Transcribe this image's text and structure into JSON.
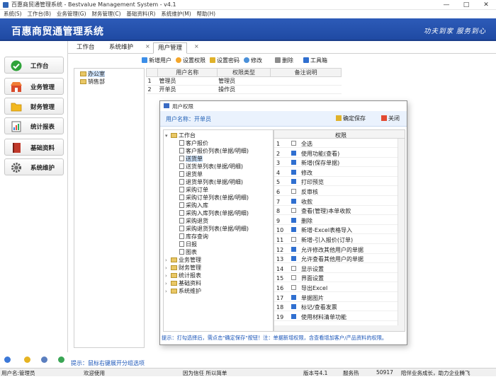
{
  "window": {
    "title": "百惠商贸通管理系统 - Bestvalue Management System - v4.1"
  },
  "menu": [
    "系统(S)",
    "工作台(B)",
    "业务管理(G)",
    "财务管理(C)",
    "基础资料(R)",
    "系统维护(M)",
    "帮助(H)"
  ],
  "banner": {
    "logo": "百惠商贸通管理系统",
    "slogan": "功夫到家 服务到心"
  },
  "nav": [
    {
      "label": "工作台",
      "icon": "check-icon"
    },
    {
      "label": "业务管理",
      "icon": "store-icon"
    },
    {
      "label": "财务管理",
      "icon": "folder-icon"
    },
    {
      "label": "统计报表",
      "icon": "report-icon"
    },
    {
      "label": "基础资料",
      "icon": "book-icon"
    },
    {
      "label": "系统维护",
      "icon": "gear-icon"
    }
  ],
  "tabs": [
    "工作台",
    "系统维护",
    "用户管理"
  ],
  "toolbar": {
    "add": "新增用户",
    "perm": "设置权限",
    "pwd": "设置密码",
    "edit": "修改",
    "del": "删除",
    "tools": "工具箱"
  },
  "org_tree": [
    "办公室",
    "销售部"
  ],
  "users": {
    "headers": [
      "用户名称",
      "权限类型",
      "备注说明"
    ],
    "rows": [
      {
        "n": "1",
        "name": "管理员",
        "type": "管理员",
        "note": ""
      },
      {
        "n": "2",
        "name": "开单员",
        "type": "操作员",
        "note": ""
      }
    ]
  },
  "hint": "提示：鼠标右键展开分组选项",
  "dialog": {
    "title": "用户权限",
    "user_name": "用户名称：开单员",
    "save": "确定保存",
    "close": "关闭",
    "tree": [
      "工作台",
      "客户报价",
      "客户报价列表(单据/明细)",
      "送货单",
      "送货单列表(单据/明细)",
      "退货单",
      "退货单列表(单据/明细)",
      "采购订单",
      "采购订单列表(单据/明细)",
      "采购入库",
      "采购入库列表(单据/明细)",
      "采购退货",
      "采购退货列表(单据/明细)",
      "库存查询",
      "日报",
      "图表",
      "业务管理",
      "财务管理",
      "统计报表",
      "基础资料",
      "系统维护"
    ],
    "grid_header": "权限",
    "perms": [
      {
        "n": "1",
        "label": "全选",
        "checked": false
      },
      {
        "n": "2",
        "label": "使用功能(查看)",
        "checked": true
      },
      {
        "n": "3",
        "label": "新增(保存单据)",
        "checked": true
      },
      {
        "n": "4",
        "label": "修改",
        "checked": true
      },
      {
        "n": "5",
        "label": "打印预览",
        "checked": true
      },
      {
        "n": "6",
        "label": "反审核",
        "checked": false
      },
      {
        "n": "7",
        "label": "收款",
        "checked": true
      },
      {
        "n": "8",
        "label": "查看(管理)本单收款",
        "checked": false
      },
      {
        "n": "9",
        "label": "删除",
        "checked": true
      },
      {
        "n": "10",
        "label": "新增-Excel表格导入",
        "checked": true
      },
      {
        "n": "11",
        "label": "新增-引入报价(订单)",
        "checked": false
      },
      {
        "n": "12",
        "label": "允许修改其他用户的单据",
        "checked": true
      },
      {
        "n": "13",
        "label": "允许查看其他用户的单据",
        "checked": true
      },
      {
        "n": "14",
        "label": "显示设置",
        "checked": false
      },
      {
        "n": "15",
        "label": "界面设置",
        "checked": false
      },
      {
        "n": "16",
        "label": "导出Excel",
        "checked": false
      },
      {
        "n": "17",
        "label": "单据图片",
        "checked": true
      },
      {
        "n": "18",
        "label": "标记/查看发票",
        "checked": true
      },
      {
        "n": "19",
        "label": "使用材料清单功能",
        "checked": true
      }
    ],
    "footer_hint": "提示：打勾选择后，需点击\"确定保存\"按钮！注：单据新增权限，含查看增加客户/产品资料的权限。"
  },
  "status": {
    "user": "用户名:管理员",
    "welcome": "欢迎使用",
    "motto": "因为信任 所以简单",
    "version": "版本号4.1",
    "service_label": "服务热",
    "service_no": "50917",
    "tagline": "陪伴业务成长，助力企业腾飞"
  }
}
